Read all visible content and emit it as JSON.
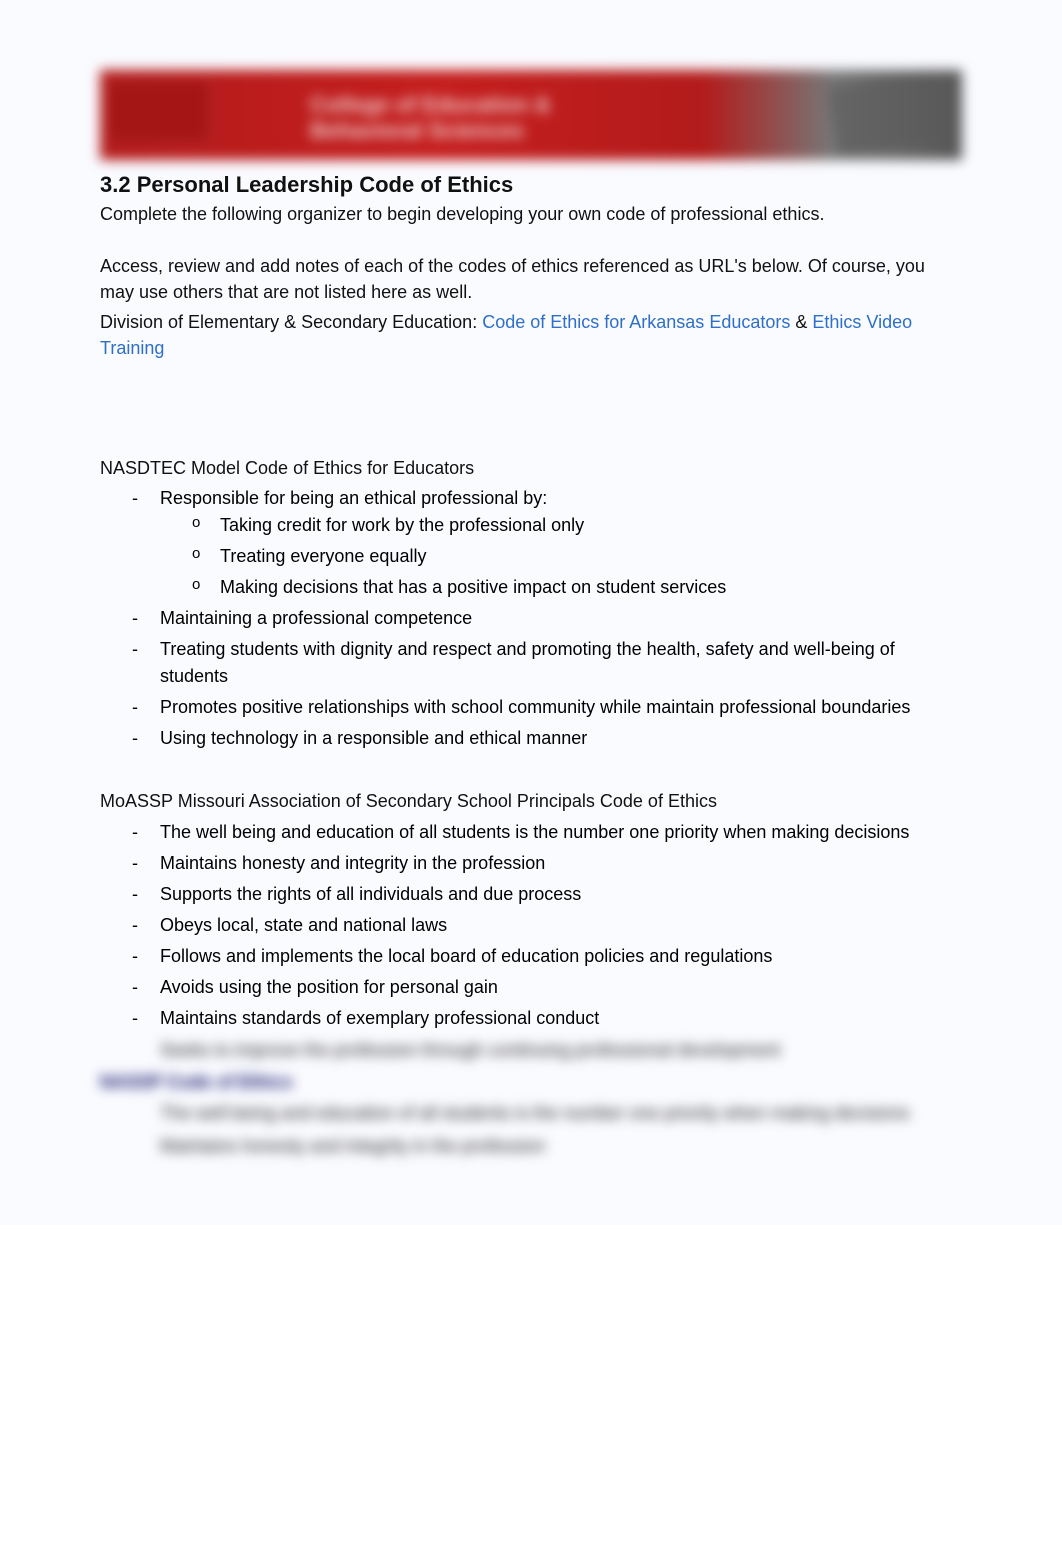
{
  "banner": {
    "text_line1": "College of Education &",
    "text_line2": "Behavioral Sciences"
  },
  "heading": {
    "number_title": "3.2 Personal Leadership Code of Ethics",
    "intro": "Complete the following organizer to begin developing your own code of professional ethics."
  },
  "access": {
    "line1": "Access, review and add notes of each of the codes of ethics referenced as URL's below. Of course, you may use others that are not listed here as well.",
    "line2_prefix": "Division of Elementary & Secondary Education: ",
    "link1": "Code of Ethics for Arkansas Educators",
    "amp": " & ",
    "link2": "Ethics Video Training"
  },
  "nasdtec": {
    "title": "NASDTEC Model Code of Ethics for Educators",
    "item1": "Responsible for being an ethical professional by:",
    "sub1": "Taking credit for work by the professional only",
    "sub2": "Treating everyone equally",
    "sub3": "Making decisions that has a positive impact on student services",
    "item2": "Maintaining a professional competence",
    "item3": "Treating students with dignity and respect and promoting the health, safety and well-being of students",
    "item4": "Promotes positive relationships with school community while maintain professional boundaries",
    "item5": "Using technology in a responsible and ethical manner"
  },
  "moassp": {
    "title": "MoASSP Missouri Association of Secondary School Principals Code of Ethics",
    "item1": "The well being and education of all students is the number one priority when making decisions",
    "item2": "Maintains honesty and integrity in the profession",
    "item3": "Supports the rights of all individuals and due process",
    "item4": "Obeys local, state and national laws",
    "item5": "Follows and implements the local board of education policies and regulations",
    "item6": "Avoids using the position for personal gain",
    "item7": "Maintains standards of exemplary professional conduct"
  },
  "blurred": {
    "lead_in": "Seeks to improve the profession through continuing professional development",
    "heading": "NASSP Code of Ethics",
    "row1": "The well being and education of all students is the number one priority when making decisions",
    "row2": "Maintains honesty and integrity in the profession"
  }
}
